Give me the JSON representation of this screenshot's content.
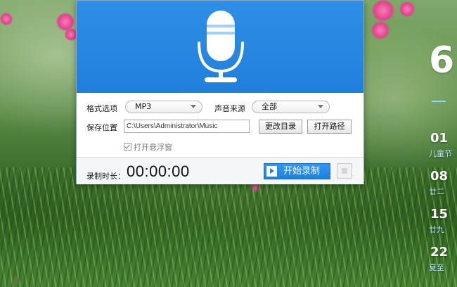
{
  "window": {
    "format_label": "格式选项",
    "format_value": "MP3",
    "source_label": "声音来源",
    "source_value": "全部",
    "save_label": "保存位置",
    "save_path": "C:\\Users\\Administrator\\Music",
    "change_dir_button": "更改目录",
    "open_path_button": "打开路径",
    "float_window_label": "打开悬浮窗",
    "float_window_checked": true,
    "duration_label": "录制时长：",
    "timer": "00:00:00",
    "start_button": "开始录制"
  },
  "calendar": {
    "big_number": "6",
    "days": [
      {
        "day": "01",
        "note": "儿童节"
      },
      {
        "day": "08",
        "note": "廿二"
      },
      {
        "day": "15",
        "note": "廿九"
      },
      {
        "day": "22",
        "note": "夏至"
      }
    ]
  },
  "colors": {
    "accent": "#1f7fdc",
    "banner": "#2f8fe6"
  }
}
